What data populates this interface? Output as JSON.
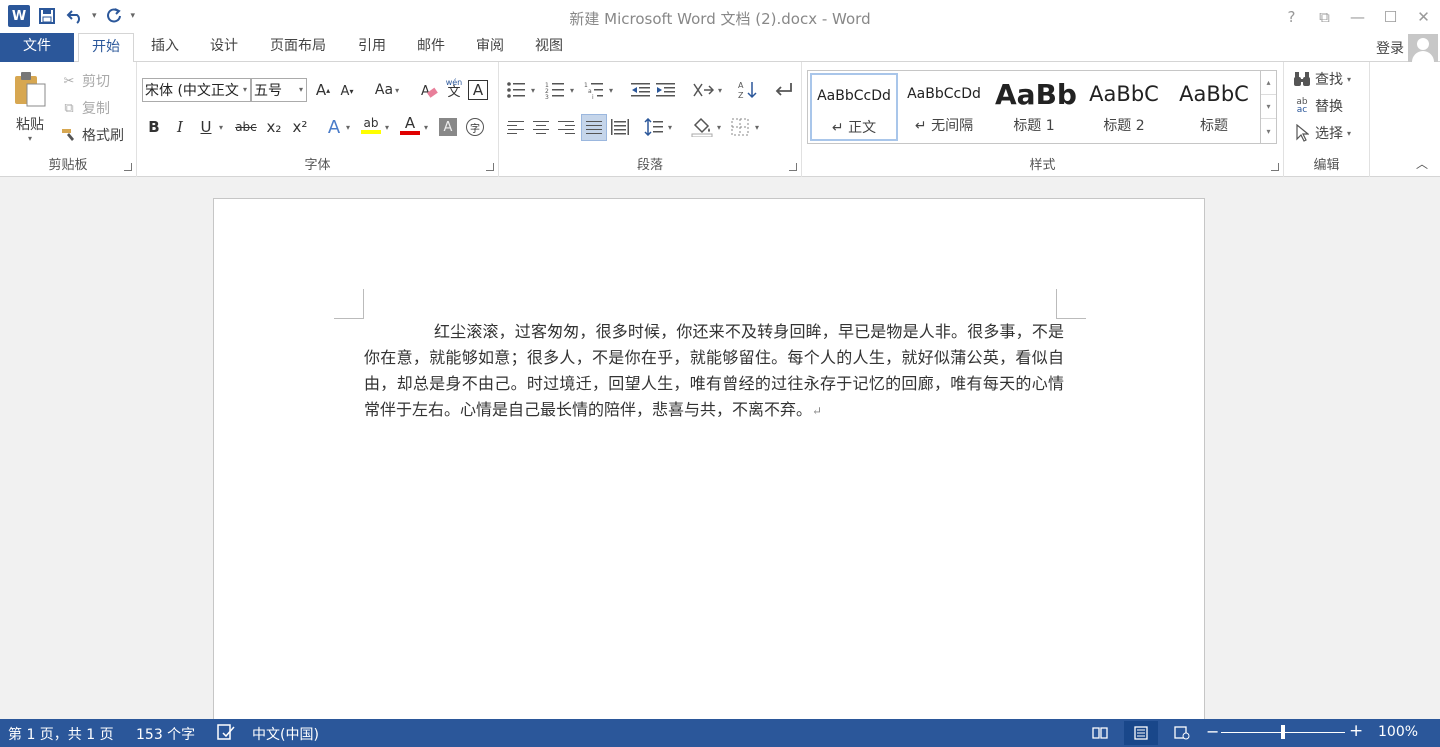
{
  "window": {
    "title": "新建 Microsoft Word 文档 (2).docx - Word",
    "app_letter": "W",
    "controls": [
      "?",
      "⧉",
      "—",
      "☐",
      "✕"
    ]
  },
  "tabs": {
    "file": "文件",
    "items": [
      "开始",
      "插入",
      "设计",
      "页面布局",
      "引用",
      "邮件",
      "审阅",
      "视图"
    ],
    "login": "登录"
  },
  "clipboard": {
    "paste": "粘贴",
    "cut": "剪切",
    "copy": "复制",
    "format_painter": "格式刷",
    "label": "剪贴板"
  },
  "font": {
    "font_name": "宋体 (中文正文",
    "font_size": "五号",
    "label": "字体",
    "grow": "A",
    "shrink": "A",
    "change_case": "Aa",
    "phonetic_top": "wén",
    "phonetic_bottom": "文",
    "char_border": "A",
    "bold": "B",
    "italic": "I",
    "underline": "U",
    "strike": "abc",
    "subscript": "x₂",
    "superscript": "x²",
    "text_effect": "A",
    "highlight": "ab",
    "font_color": "A",
    "char_shading": "A",
    "enclose": "字"
  },
  "paragraph": {
    "label": "段落"
  },
  "styles": {
    "label": "样式",
    "items": [
      {
        "preview": "AaBbCcDd",
        "name": "↵ 正文"
      },
      {
        "preview": "AaBbCcDd",
        "name": "↵ 无间隔"
      },
      {
        "preview": "AaBb",
        "name": "标题 1"
      },
      {
        "preview": "AaBbC",
        "name": "标题 2"
      },
      {
        "preview": "AaBbC",
        "name": "标题"
      }
    ]
  },
  "editing": {
    "label": "编辑",
    "find": "查找",
    "replace": "替换",
    "select": "选择"
  },
  "document": {
    "text": "红尘滚滚，过客匆匆，很多时候，你还来不及转身回眸，早已是物是人非。很多事，不是你在意，就能够如意；很多人，不是你在乎，就能够留住。每个人的人生，就好似蒲公英，看似自由，却总是身不由己。时过境迁，回望人生，唯有曾经的过往永存于记忆的回廊，唯有每天的心情常伴于左右。心情是自己最长情的陪伴，悲喜与共，不离不弃。",
    "pilcrow": "↵"
  },
  "status": {
    "page": "第 1 页，共 1 页",
    "words": "153 个字",
    "language": "中文(中国)",
    "zoom": "100%",
    "zoom_minus": "−",
    "zoom_plus": "+"
  },
  "colors": {
    "accent": "#2b579a",
    "highlight": "#ffff00",
    "font_color": "#e00000"
  }
}
